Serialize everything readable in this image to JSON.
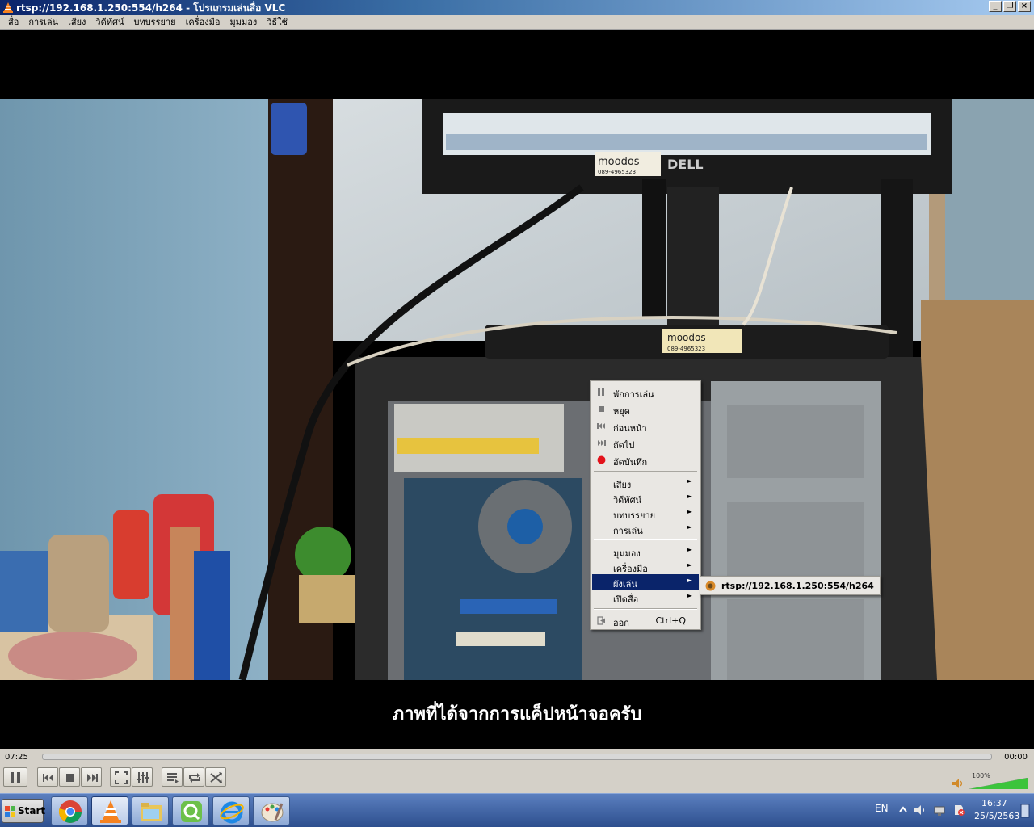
{
  "window": {
    "title": "rtsp://192.168.1.250:554/h264 - โปรแกรมเล่นสื่อ VLC"
  },
  "menubar": [
    "สื่อ",
    "การเล่น",
    "เสียง",
    "วิดีทัศน์",
    "บทบรรยาย",
    "เครื่องมือ",
    "มุมมอง",
    "วิธีใช้"
  ],
  "video": {
    "subtitle": "ภาพที่ได้จากการแค็ปหน้าจอครับ",
    "sticker_1": "moodos",
    "sticker_1_phone": "089-4965323",
    "sticker_2": "moodos",
    "sticker_2_phone": "089-4965323",
    "monitor_brand": "DELL"
  },
  "context_menu": {
    "items": [
      {
        "label": "พักการเล่น",
        "icon": "pause-icon"
      },
      {
        "label": "หยุด",
        "icon": "stop-icon"
      },
      {
        "label": "ก่อนหน้า",
        "icon": "previous-icon"
      },
      {
        "label": "ถัดไป",
        "icon": "next-icon"
      },
      {
        "label": "อัดบันทึก",
        "icon": "record-icon"
      },
      {
        "label": "เสียง",
        "submenu": true
      },
      {
        "label": "วิดีทัศน์",
        "submenu": true
      },
      {
        "label": "บทบรรยาย",
        "submenu": true
      },
      {
        "label": "การเล่น",
        "submenu": true
      },
      {
        "label": "มุมมอง",
        "submenu": true
      },
      {
        "label": "เครื่องมือ",
        "submenu": true
      },
      {
        "label": "ผังเล่น",
        "submenu": true,
        "selected": true
      },
      {
        "label": "เปิดสื่อ",
        "submenu": true
      },
      {
        "label": "ออก",
        "icon": "exit-icon",
        "shortcut": "Ctrl+Q"
      }
    ],
    "arrow": "►"
  },
  "submenu": {
    "label": "rtsp://192.168.1.250:554/h264",
    "icon": "vlc-cone-icon"
  },
  "controls": {
    "time_elapsed": "07:25",
    "time_total": "00:00",
    "seek_progress": 0.0,
    "volume_label": "100%",
    "volume": 1.0
  },
  "taskbar": {
    "start_label": "Start",
    "apps": [
      "chrome-icon",
      "vlc-icon",
      "file-explorer-icon",
      "qbittorrent-icon",
      "internet-explorer-icon",
      "paint-icon"
    ],
    "language": "EN",
    "clock_time": "16:37",
    "clock_date": "25/5/2563"
  },
  "colors": {
    "menu_highlight": "#0a246a",
    "titlebar": "#0b246a",
    "window_face": "#d4d0c8"
  }
}
